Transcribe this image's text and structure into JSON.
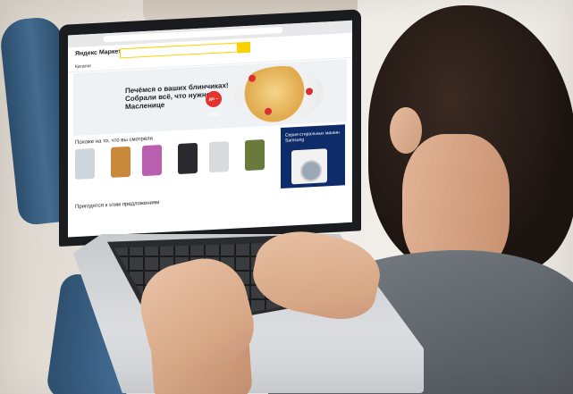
{
  "photo": {
    "subject": "",
    "screen": {
      "logo": "Яндекс Маркет",
      "catalog_label": "Каталог",
      "banner_headline": "Печёмся о ваших блинчиках! Собрали всё, что нужно к Масленице",
      "banner_badge": "до –70%",
      "section_recent": "Похоже на то, что вы смотрели",
      "ad_text": "Серия стиральных машин Samsung",
      "section_suggest": "Пригодятся к этим предложениям"
    },
    "colors": {
      "accent_yellow": "#fdd000",
      "badge_red": "#e5322d",
      "ad_blue": "#0e2c6a"
    }
  }
}
